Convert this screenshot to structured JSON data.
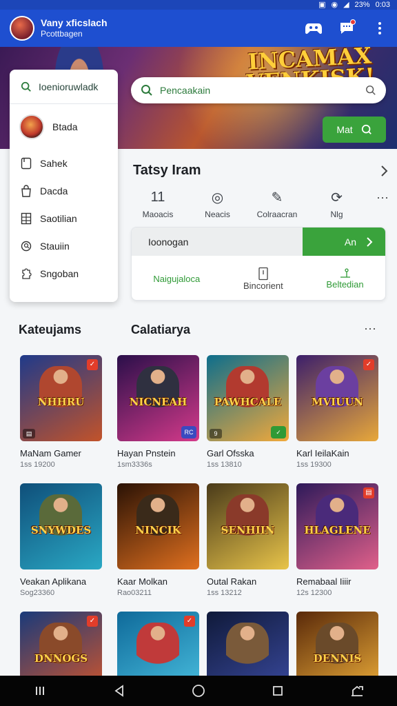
{
  "status_bar": {
    "icons": [
      "nfc-icon",
      "wifi-icon",
      "signal-icon"
    ],
    "battery": "23%",
    "time": "0:03"
  },
  "app_bar": {
    "title": "Vany xficslach",
    "subtitle": "Pcottbagen",
    "actions": [
      "game-controller-icon",
      "chat-icon",
      "more-vert-icon"
    ]
  },
  "banner": {
    "headline_line1": "INCAMAX",
    "headline_line2": "VENKISK!",
    "button_label": "Mat"
  },
  "search": {
    "placeholder": "Pencaakain"
  },
  "drawer": {
    "search_text": "Ioenioruwladk",
    "user_name": "Btada",
    "items": [
      {
        "label": "Sahek",
        "icon": "bookmark-icon"
      },
      {
        "label": "Dacda",
        "icon": "bag-icon"
      },
      {
        "label": "Saotilian",
        "icon": "grid-doc-icon"
      },
      {
        "label": "Stauiin",
        "icon": "search-circle-icon"
      },
      {
        "label": "Sngoban",
        "icon": "puzzle-icon"
      }
    ]
  },
  "quick": {
    "title": "Tatsy  Iram",
    "items": [
      {
        "glyph": "11",
        "label": "Maoacis"
      },
      {
        "glyph": "◎",
        "label": "Neacis"
      },
      {
        "glyph": "✎",
        "label": "Colraacran"
      },
      {
        "glyph": "⟳",
        "label": "Nlg"
      }
    ],
    "more": "···"
  },
  "action_card": {
    "top_label": "Ioonogan",
    "top_button": "An",
    "cells": [
      {
        "label": "Naigujaloca",
        "icon": ""
      },
      {
        "label": "Bincorient",
        "icon": "document-icon"
      },
      {
        "label": "Beltedian",
        "icon": "chart-icon"
      }
    ]
  },
  "sections": {
    "left": "Kateujams",
    "middle": "Calatiarya",
    "more": "···"
  },
  "games": [
    {
      "name": "MaNam Gamer",
      "meta": "1ss 19200",
      "logo": "NHHRU",
      "colors": [
        "#1f3a8a",
        "#c2532a"
      ],
      "hero": "#b0472f",
      "badge": "✓",
      "badge_bl": "▤",
      "badge_br": ""
    },
    {
      "name": "Hayan Pnstein",
      "meta": "1sm3336s",
      "logo": "NICNEAH",
      "colors": [
        "#2a0f4a",
        "#d43a8a"
      ],
      "hero": "#2f3040",
      "badge": "",
      "badge_bl": "",
      "badge_br": "RC"
    },
    {
      "name": "Garl Ofsska",
      "meta": "1ss 13810",
      "logo": "PAWHCALE",
      "colors": [
        "#0d6e8c",
        "#f2a93b"
      ],
      "hero": "#b23a2f",
      "badge": "",
      "badge_bl": "9",
      "badge_br": "✓"
    },
    {
      "name": "Karl IeilaKain",
      "meta": "1ss 19300",
      "logo": "MVIUUN",
      "colors": [
        "#3c1f6b",
        "#e8a83a"
      ],
      "hero": "#6b3fa0",
      "badge": "✓",
      "badge_bl": "",
      "badge_br": ""
    },
    {
      "name": "Veakan Aplikana",
      "meta": "Sog23360",
      "logo": "SNYWDES",
      "colors": [
        "#0f4f7a",
        "#2aa8c4"
      ],
      "hero": "#5a6a3a",
      "badge": "",
      "badge_bl": "",
      "badge_br": ""
    },
    {
      "name": "Kaar Molkan",
      "meta": "Rao03211",
      "logo": "NINCIK",
      "colors": [
        "#2a1205",
        "#e0701f"
      ],
      "hero": "#3a2a1a",
      "badge": "",
      "badge_bl": "",
      "badge_br": ""
    },
    {
      "name": "Outal Rakan",
      "meta": "1ss 13212",
      "logo": "SENHIIN",
      "colors": [
        "#4a3b1a",
        "#e8c44a"
      ],
      "hero": "#8a3a2a",
      "badge": "",
      "badge_bl": "",
      "badge_br": ""
    },
    {
      "name": "Remabaal Iiiir",
      "meta": "12s 12300",
      "logo": "HLAGLENE",
      "colors": [
        "#2e1a5a",
        "#e0608a"
      ],
      "hero": "#4a2a7a",
      "badge": "▤",
      "badge_bl": "",
      "badge_br": ""
    },
    {
      "name": "",
      "meta": "",
      "logo": "DNNOGS",
      "colors": [
        "#1a3a7a",
        "#d4562a"
      ],
      "hero": "#8a4a2a",
      "badge": "✓",
      "badge_bl": "",
      "badge_br": ""
    },
    {
      "name": "",
      "meta": "",
      "logo": "",
      "colors": [
        "#0f6a9a",
        "#4ac0e0"
      ],
      "hero": "#c03a3a",
      "badge": "✓",
      "badge_bl": "",
      "badge_br": ""
    },
    {
      "name": "",
      "meta": "",
      "logo": "",
      "colors": [
        "#101a3a",
        "#3a4aa0"
      ],
      "hero": "#7a5a3a",
      "badge": "",
      "badge_bl": "",
      "badge_br": ""
    },
    {
      "name": "",
      "meta": "",
      "logo": "DENNIS",
      "colors": [
        "#5a2a0a",
        "#f0b03a"
      ],
      "hero": "#6a4a2a",
      "badge": "",
      "badge_bl": "",
      "badge_br": ""
    }
  ],
  "nav_bar": [
    "recents-icon",
    "back-icon",
    "home-icon",
    "overview-icon",
    "screenshot-icon"
  ]
}
